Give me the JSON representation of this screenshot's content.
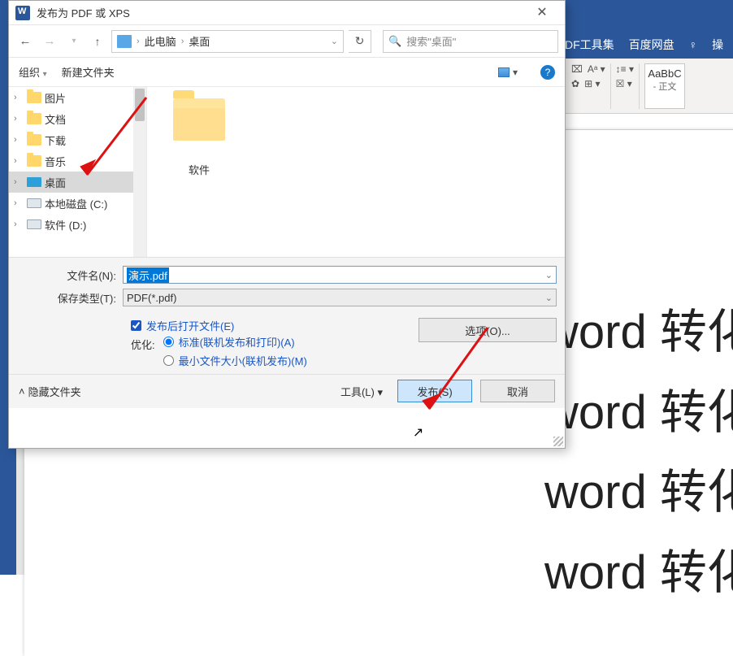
{
  "word": {
    "tab_pdf": "DF工具集",
    "tab_baidu": "百度网盘",
    "tell_me_prefix": "操",
    "style_big": "AaBbC",
    "style_small": "- 正文",
    "doc_line": "word 转化"
  },
  "dlg": {
    "title": "发布为 PDF 或 XPS",
    "crumb_pc": "此电脑",
    "crumb_desktop": "桌面",
    "search_placeholder": "搜索\"桌面\"",
    "organize": "组织",
    "new_folder": "新建文件夹",
    "tree": {
      "pictures": "图片",
      "documents": "文档",
      "downloads": "下载",
      "music": "音乐",
      "desktop": "桌面",
      "drive_c": "本地磁盘 (C:)",
      "drive_d": "软件 (D:)"
    },
    "folder_item": "软件",
    "filename_label": "文件名(N):",
    "filename_value": "演示.pdf",
    "savetype_label": "保存类型(T):",
    "savetype_value": "PDF(*.pdf)",
    "open_after": "发布后打开文件(E)",
    "optimize_label": "优化:",
    "opt_standard": "标准(联机发布和打印)(A)",
    "opt_min": "最小文件大小(联机发布)(M)",
    "options_btn": "选项(O)...",
    "hide_folders": "隐藏文件夹",
    "tools": "工具(L)",
    "publish": "发布(S)",
    "cancel": "取消"
  }
}
